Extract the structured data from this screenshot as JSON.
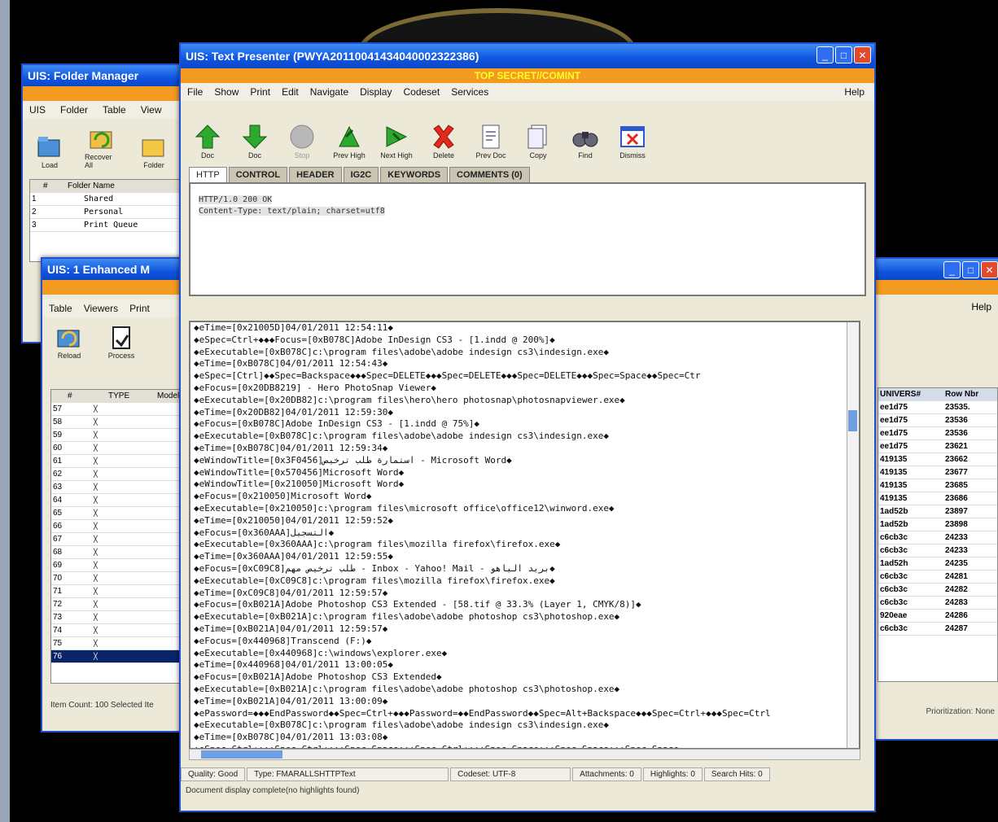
{
  "folder_manager": {
    "title": "UIS: Folder Manager",
    "menu": [
      "UIS",
      "Folder",
      "Table",
      "View"
    ],
    "tools": [
      "Load",
      "Recover All",
      "Folder"
    ],
    "columns": [
      "#",
      "Folder Name"
    ],
    "rows": [
      {
        "num": "1",
        "name": "Shared"
      },
      {
        "num": "2",
        "name": "Personal"
      },
      {
        "num": "3",
        "name": "Print Queue"
      }
    ]
  },
  "enhanced_window": {
    "title": "UIS: 1 Enhanced M",
    "menu": [
      "Table",
      "Viewers",
      "Print"
    ],
    "tools": [
      "Reload",
      "Process"
    ],
    "columns": [
      "#",
      "TYPE",
      "Model"
    ],
    "row_numbers": [
      "57",
      "58",
      "59",
      "60",
      "61",
      "62",
      "63",
      "64",
      "65",
      "66",
      "67",
      "68",
      "69",
      "70",
      "71",
      "72",
      "73",
      "74",
      "75",
      "76"
    ],
    "status": "Item Count: 100  Selected Ite"
  },
  "right_window": {
    "help": "Help",
    "columns": [
      "UNIVERS#",
      "Row Nbr"
    ],
    "rows": [
      [
        "ee1d75",
        "23535."
      ],
      [
        "ee1d75",
        "23536"
      ],
      [
        "ee1d75",
        "23536"
      ],
      [
        "ee1d75",
        "23621"
      ],
      [
        "419135",
        "23662"
      ],
      [
        "419135",
        "23677"
      ],
      [
        "419135",
        "23685"
      ],
      [
        "419135",
        "23686"
      ],
      [
        "1ad52b",
        "23897"
      ],
      [
        "1ad52b",
        "23898"
      ],
      [
        "c6cb3c",
        "24233"
      ],
      [
        "c6cb3c",
        "24233"
      ],
      [
        "1ad52h",
        "24235"
      ],
      [
        "c6cb3c",
        "24281"
      ],
      [
        "c6cb3c",
        "24282"
      ],
      [
        "c6cb3c",
        "24283"
      ],
      [
        "920eae",
        "24286"
      ],
      [
        "c6cb3c",
        "24287"
      ]
    ],
    "status": "Prioritization: None"
  },
  "text_presenter": {
    "title": "UIS: Text Presenter (PWYA20110041434040002322386)",
    "classification": "TOP SECRET//COMINT",
    "menu": [
      "File",
      "Show",
      "Print",
      "Edit",
      "Navigate",
      "Display",
      "Codeset",
      "Services"
    ],
    "help": "Help",
    "tools": [
      "Doc",
      "Doc",
      "Stop",
      "Prev High",
      "Next High",
      "Delete",
      "Prev Doc",
      "Copy",
      "Find",
      "Dismiss"
    ],
    "tabs": [
      "HTTP",
      "CONTROL",
      "HEADER",
      "IG2C",
      "KEYWORDS",
      "COMMENTS (0)"
    ],
    "header_lines": [
      "HTTP/1.0 200 OK",
      "Content-Type: text/plain; charset=utf8"
    ],
    "log_lines": [
      "◆eTime=[0x21005D]04/01/2011 12:54:11◆",
      "◆eSpec=Ctrl+◆◆◆Focus=[0xB078C]Adobe InDesign CS3 - [1.indd @ 200%]◆",
      "◆eExecutable=[0xB078C]c:\\program files\\adobe\\adobe indesign cs3\\indesign.exe◆",
      "◆eTime=[0xB078C]04/01/2011 12:54:43◆",
      "◆eSpec=[Ctrl]◆◆Spec=Backspace◆◆◆Spec=DELETE◆◆◆Spec=DELETE◆◆◆Spec=DELETE◆◆◆Spec=Space◆◆Spec=Ctr",
      "◆eFocus=[0x20DB8219] - Hero PhotoSnap Viewer◆",
      "◆eExecutable=[0x20DB82]c:\\program files\\hero\\hero photosnap\\photosnapviewer.exe◆",
      "◆eTime=[0x20DB82]04/01/2011 12:59:30◆",
      "◆eFocus=[0xB078C]Adobe InDesign CS3 - [1.indd @ 75%]◆",
      "◆eExecutable=[0xB078C]c:\\program files\\adobe\\adobe indesign cs3\\indesign.exe◆",
      "◆eTime=[0xB078C]04/01/2011 12:59:34◆",
      "◆eWindowTitle=[0x3F0456]استمارة طلب ترخيص - Microsoft Word◆",
      "◆eWindowTitle=[0x570456]Microsoft Word◆",
      "◆eWindowTitle=[0x210050]Microsoft Word◆",
      "◆eFocus=[0x210050]Microsoft Word◆",
      "◆eExecutable=[0x210050]c:\\program files\\microsoft office\\office12\\winword.exe◆",
      "◆eTime=[0x210050]04/01/2011 12:59:52◆",
      "◆eFocus=[0x360AAA]التسجيل◆",
      "◆eExecutable=[0x360AAA]c:\\program files\\mozilla firefox\\firefox.exe◆",
      "◆eTime=[0x360AAA]04/01/2011 12:59:55◆",
      "◆eFocus=[0xC09C8]طلب ترخيص مهم - Inbox - Yahoo! Mail - بريد الياهو◆",
      "◆eExecutable=[0xC09C8]c:\\program files\\mozilla firefox\\firefox.exe◆",
      "◆eTime=[0xC09C8]04/01/2011 12:59:57◆",
      "◆eFocus=[0xB021A]Adobe Photoshop CS3 Extended - [58.tif @ 33.3% (Layer 1, CMYK/8)]◆",
      "◆eExecutable=[0xB021A]c:\\program files\\adobe\\adobe photoshop cs3\\photoshop.exe◆",
      "◆eTime=[0xB021A]04/01/2011 12:59:57◆",
      "◆eFocus=[0x440968]Transcend (F:)◆",
      "◆eExecutable=[0x440968]c:\\windows\\explorer.exe◆",
      "◆eTime=[0x440968]04/01/2011 13:00:05◆",
      "◆eFocus=[0xB021A]Adobe Photoshop CS3 Extended◆",
      "◆eExecutable=[0xB021A]c:\\program files\\adobe\\adobe photoshop cs3\\photoshop.exe◆",
      "◆eTime=[0xB021A]04/01/2011 13:00:09◆",
      "◆ePassword=◆◆◆EndPassword◆◆Spec=Ctrl+◆◆◆Password=◆◆EndPassword◆◆Spec=Alt+Backspace◆◆◆Spec=Ctrl+◆◆◆Spec=Ctrl",
      "◆eExecutable=[0xB078C]c:\\program files\\adobe\\adobe indesign cs3\\indesign.exe◆",
      "◆eTime=[0xB078C]04/01/2011 13:03:08◆",
      "◆eSpec=Ctrl+◆◆◆Spec=Ctrl+◆◆◆Spec=Space◆◆◆Spec=Ctrl+◆◆◆Spec=Space◆◆◆Spec=Space◆◆◆Spec=Space"
    ],
    "status": {
      "quality": "Quality: Good",
      "type": "Type: FMARALLSHTTPText",
      "codeset": "Codeset: UTF-8",
      "attachments": "Attachments: 0",
      "highlights": "Highlights: 0",
      "search_hits": "Search Hits: 0"
    },
    "status_message": "Document display complete(no highlights found)"
  }
}
